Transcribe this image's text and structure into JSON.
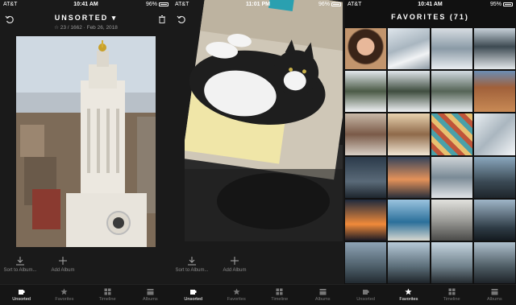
{
  "screens": [
    {
      "status": {
        "carrier": "AT&T",
        "time": "10:41 AM",
        "battery": "96%"
      },
      "header": {
        "title": "UNSORTED",
        "subtitle": "☆ 23 / 1662 · Feb 26, 2018"
      },
      "actions": [
        {
          "label": "Sort to Album..."
        },
        {
          "label": "Add Album"
        }
      ],
      "tabs": [
        {
          "label": "Unsorted",
          "icon": "unsorted-icon"
        },
        {
          "label": "Favorites",
          "icon": "star-icon"
        },
        {
          "label": "Timeline",
          "icon": "grid-icon"
        },
        {
          "label": "Albums",
          "icon": "albums-icon"
        }
      ]
    },
    {
      "status": {
        "carrier": "AT&T",
        "time": "11:01 PM",
        "battery": "96%"
      },
      "actions": [
        {
          "label": "Sort to Album..."
        },
        {
          "label": "Add Album"
        }
      ],
      "tabs": [
        {
          "label": "Unsorted"
        },
        {
          "label": "Favorites"
        },
        {
          "label": "Timeline"
        },
        {
          "label": "Albums"
        }
      ]
    },
    {
      "status": {
        "carrier": "AT&T",
        "time": "10:41 AM",
        "battery": "95%"
      },
      "header": {
        "title": "FAVORITES (71)"
      },
      "tabs": [
        {
          "label": "Unsorted"
        },
        {
          "label": "Favorites"
        },
        {
          "label": "Timeline"
        },
        {
          "label": "Albums"
        }
      ]
    }
  ],
  "colors": {
    "active_tab": "#ffffff",
    "inactive_tab": "#777777",
    "background": "#1a1a1a"
  }
}
